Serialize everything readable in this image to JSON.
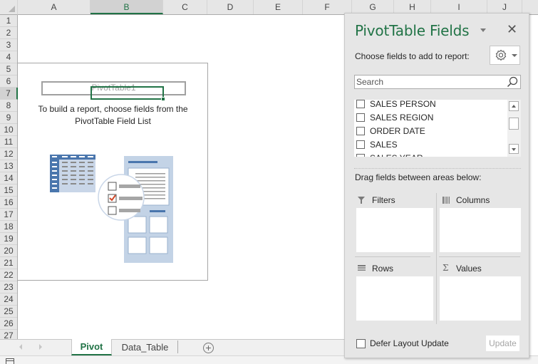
{
  "grid": {
    "columns": [
      {
        "label": "A",
        "selected": false
      },
      {
        "label": "B",
        "selected": true
      },
      {
        "label": "C",
        "selected": false
      },
      {
        "label": "D",
        "selected": false
      },
      {
        "label": "E",
        "selected": false
      },
      {
        "label": "F",
        "selected": false
      },
      {
        "label": "G",
        "selected": false
      },
      {
        "label": "H",
        "selected": false
      },
      {
        "label": "I",
        "selected": false
      },
      {
        "label": "J",
        "selected": false
      }
    ],
    "rows": [
      "1",
      "2",
      "3",
      "4",
      "5",
      "6",
      "7",
      "8",
      "9",
      "10",
      "11",
      "12",
      "13",
      "14",
      "15",
      "16",
      "17",
      "18",
      "19",
      "20",
      "21",
      "22",
      "23",
      "24",
      "25",
      "26",
      "27"
    ],
    "selected_row": "7",
    "active_cell": "B7"
  },
  "pivot_placeholder": {
    "name": "PivotTable1",
    "hint_line1": "To build a report, choose fields from the",
    "hint_line2": "PivotTable Field List"
  },
  "sheet_tabs": {
    "tabs": [
      {
        "label": "Pivot",
        "active": true
      },
      {
        "label": "Data_Table",
        "active": false
      }
    ],
    "add_icon": "plus-circle-icon"
  },
  "panel": {
    "title": "PivotTable Fields",
    "choose_label": "Choose fields to add to report:",
    "search_placeholder": "Search",
    "fields": [
      {
        "label": "SALES PERSON",
        "checked": false
      },
      {
        "label": "SALES REGION",
        "checked": false
      },
      {
        "label": "ORDER DATE",
        "checked": false
      },
      {
        "label": "SALES",
        "checked": false
      },
      {
        "label": "SALES YEAR",
        "checked": false
      }
    ],
    "drag_label": "Drag fields between areas below:",
    "areas": {
      "filters": "Filters",
      "columns": "Columns",
      "rows": "Rows",
      "values": "Values"
    },
    "defer_label": "Defer Layout Update",
    "defer_checked": false,
    "update_label": "Update",
    "accent_color": "#217346"
  }
}
